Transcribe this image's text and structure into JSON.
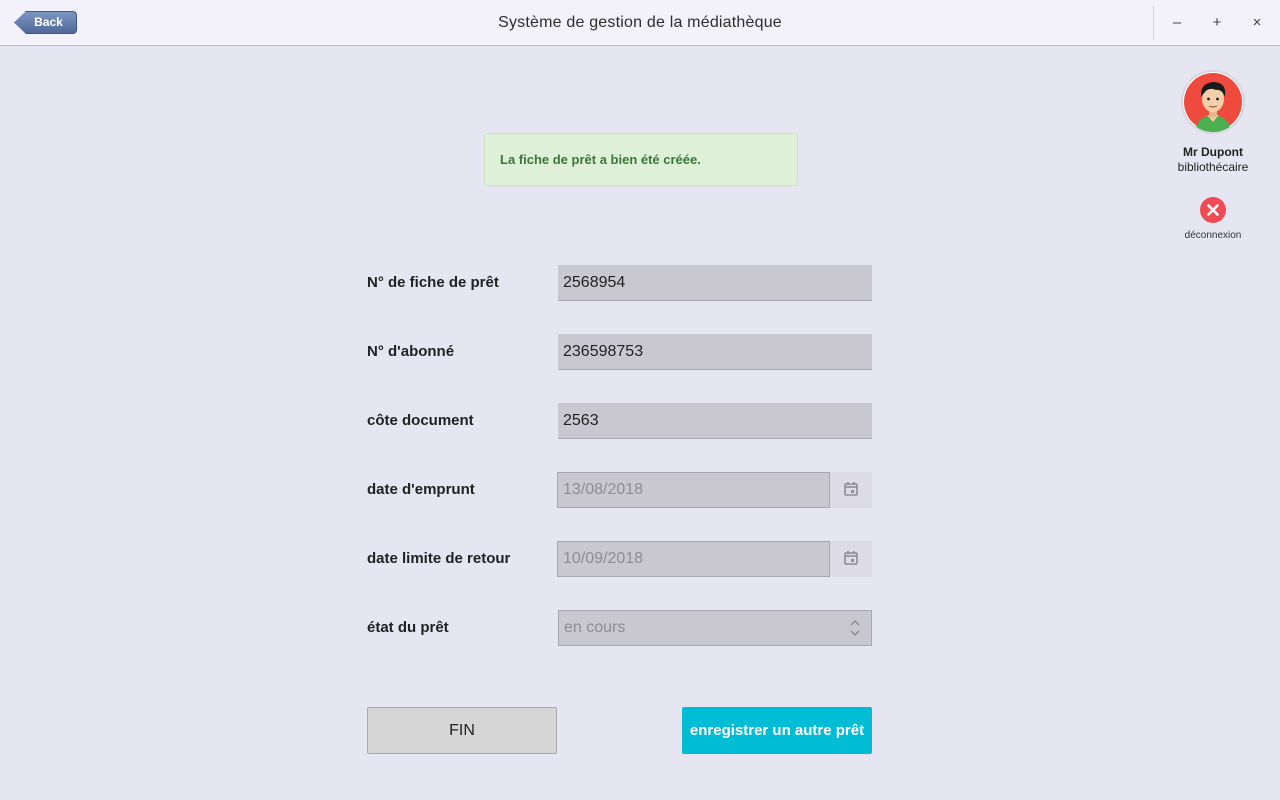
{
  "titlebar": {
    "back_label": "Back",
    "title": "Système de gestion de la médiathèque",
    "minimize_glyph": "–",
    "maximize_glyph": "+",
    "close_glyph": "×"
  },
  "alert": {
    "message": "La fiche de prêt a bien été créée.",
    "color": "#3c763d",
    "background": "#dff0d8"
  },
  "user": {
    "name": "Mr Dupont",
    "role": "bibliothécaire",
    "logout_label": "déconnexion",
    "logout_color": "#ef4b53"
  },
  "form": {
    "loan_number": {
      "label": "N° de fiche de prêt",
      "value": "2568954"
    },
    "subscriber_number": {
      "label": "N° d'abonné",
      "value": "236598753"
    },
    "document_code": {
      "label": "côte document",
      "value": "2563"
    },
    "loan_date": {
      "label": "date d'emprunt",
      "value": "13/08/2018"
    },
    "return_date": {
      "label": "date limite de retour",
      "value": "10/09/2018"
    },
    "loan_status": {
      "label": "état du prêt",
      "value": "en cours"
    }
  },
  "actions": {
    "finish_label": "FIN",
    "save_another_label": "enregistrer un autre prêt",
    "accent_color": "#00bcd4"
  }
}
